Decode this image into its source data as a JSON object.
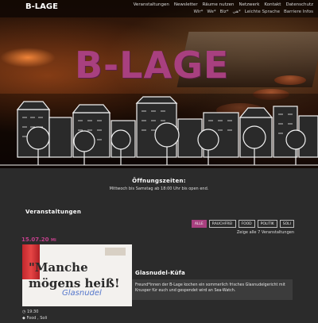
{
  "header": {
    "logo": "B-LAGE",
    "nav_primary": [
      "Veranstaltungen",
      "Newsletter",
      "Räume nutzen",
      "Netzwerk",
      "Kontakt",
      "Datenschutz"
    ],
    "nav_secondary": [
      "Wir*",
      "We*",
      "Biz*",
      "هی*",
      "Leichte Sprache",
      "Barriere Infos"
    ]
  },
  "hero": {
    "brand": "B-LAGE"
  },
  "hours": {
    "title": "Öffnungszeiten:",
    "text": "Mittwoch bis Samstag ab 18:00 Uhr bis open end."
  },
  "events": {
    "section_title": "Veranstaltungen",
    "filters": [
      "ALLE",
      "RAUCHFREI",
      "FOOD",
      "POLITIK",
      "SOLI"
    ],
    "active_filter": "ALLE",
    "show_all": "Zeige alle 7 Veranstaltungen",
    "items": [
      {
        "date": "15.07.20",
        "date_suffix": "Mi",
        "image_text_1": "\"Manche",
        "image_text_2": "mögens heiß!",
        "image_scribble": "Glasnudel",
        "title": "Glasnudel-Küfa",
        "description": "Freund*innen der B-Lage kochen ein sommerlich frisches Glasnudelgericht mit Knusper für euch und gespendet wird an Sea-Watch.",
        "time": "19:30",
        "categories": "Food , Soli"
      }
    ]
  }
}
